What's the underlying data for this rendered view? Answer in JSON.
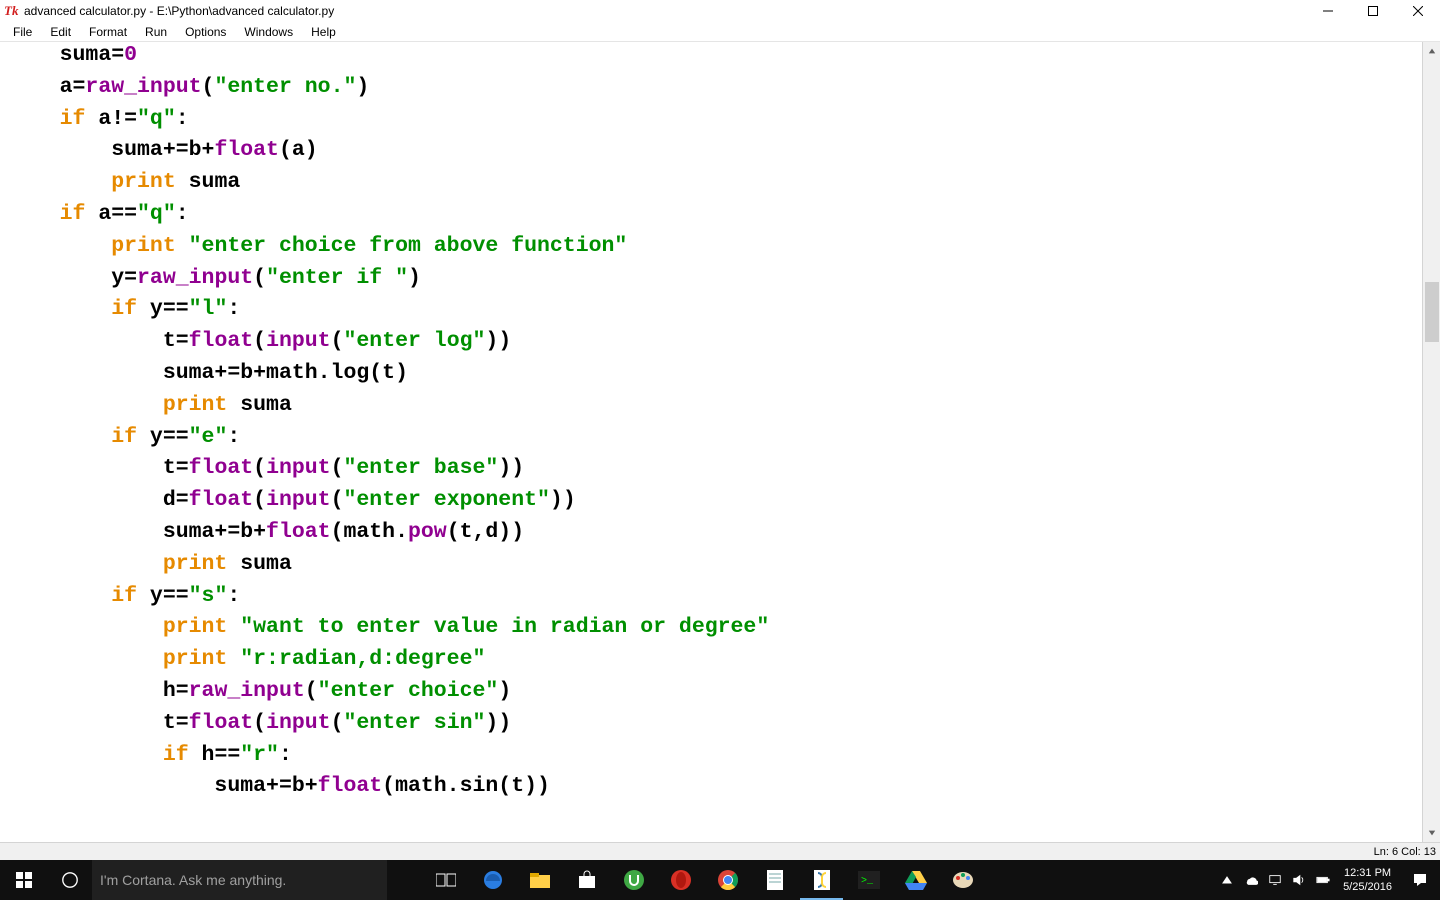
{
  "titlebar": {
    "icon_label": "Tk",
    "title": "advanced calculator.py - E:\\Python\\advanced calculator.py"
  },
  "menubar": {
    "items": [
      "File",
      "Edit",
      "Format",
      "Run",
      "Options",
      "Windows",
      "Help"
    ]
  },
  "code_tokens": [
    [
      [
        "",
        "    suma="
      ],
      [
        "fn",
        "0"
      ]
    ],
    [
      [
        "",
        "    a="
      ],
      [
        "fn",
        "raw_input"
      ],
      [
        "",
        "("
      ],
      [
        "str",
        "\"enter no.\""
      ],
      [
        "",
        ")"
      ]
    ],
    [
      [
        "",
        "    "
      ],
      [
        "kw",
        "if"
      ],
      [
        "",
        " a!="
      ],
      [
        "str",
        "\"q\""
      ],
      [
        "",
        ":"
      ]
    ],
    [
      [
        "",
        "        suma+=b+"
      ],
      [
        "fn",
        "float"
      ],
      [
        "",
        "(a)"
      ]
    ],
    [
      [
        "",
        "        "
      ],
      [
        "kw",
        "print"
      ],
      [
        "",
        " suma"
      ]
    ],
    [
      [
        "",
        "    "
      ],
      [
        "kw",
        "if"
      ],
      [
        "",
        " a=="
      ],
      [
        "str",
        "\"q\""
      ],
      [
        "",
        ":"
      ]
    ],
    [
      [
        "",
        "        "
      ],
      [
        "kw",
        "print"
      ],
      [
        "",
        " "
      ],
      [
        "str",
        "\"enter choice from above function\""
      ]
    ],
    [
      [
        "",
        "        y="
      ],
      [
        "fn",
        "raw_input"
      ],
      [
        "",
        "("
      ],
      [
        "str",
        "\"enter if \""
      ],
      [
        "",
        ")"
      ]
    ],
    [
      [
        "",
        "        "
      ],
      [
        "kw",
        "if"
      ],
      [
        "",
        " y=="
      ],
      [
        "str",
        "\"l\""
      ],
      [
        "",
        ":"
      ]
    ],
    [
      [
        "",
        "            t="
      ],
      [
        "fn",
        "float"
      ],
      [
        "",
        "("
      ],
      [
        "fn",
        "input"
      ],
      [
        "",
        "("
      ],
      [
        "str",
        "\"enter log\""
      ],
      [
        "",
        "))"
      ]
    ],
    [
      [
        "",
        "            suma+=b+math.log(t)"
      ]
    ],
    [
      [
        "",
        "            "
      ],
      [
        "kw",
        "print"
      ],
      [
        "",
        " suma"
      ]
    ],
    [
      [
        "",
        "        "
      ],
      [
        "kw",
        "if"
      ],
      [
        "",
        " y=="
      ],
      [
        "str",
        "\"e\""
      ],
      [
        "",
        ":"
      ]
    ],
    [
      [
        "",
        "            t="
      ],
      [
        "fn",
        "float"
      ],
      [
        "",
        "("
      ],
      [
        "fn",
        "input"
      ],
      [
        "",
        "("
      ],
      [
        "str",
        "\"enter base\""
      ],
      [
        "",
        "))"
      ]
    ],
    [
      [
        "",
        "            d="
      ],
      [
        "fn",
        "float"
      ],
      [
        "",
        "("
      ],
      [
        "fn",
        "input"
      ],
      [
        "",
        "("
      ],
      [
        "str",
        "\"enter exponent\""
      ],
      [
        "",
        "))"
      ]
    ],
    [
      [
        "",
        "            suma+=b+"
      ],
      [
        "fn",
        "float"
      ],
      [
        "",
        "(math."
      ],
      [
        "fn",
        "pow"
      ],
      [
        "",
        "(t,d))"
      ]
    ],
    [
      [
        "",
        "            "
      ],
      [
        "kw",
        "print"
      ],
      [
        "",
        " suma"
      ]
    ],
    [
      [
        "",
        "        "
      ],
      [
        "kw",
        "if"
      ],
      [
        "",
        " y=="
      ],
      [
        "str",
        "\"s\""
      ],
      [
        "",
        ":"
      ]
    ],
    [
      [
        "",
        "            "
      ],
      [
        "kw",
        "print"
      ],
      [
        "",
        " "
      ],
      [
        "str",
        "\"want to enter value in radian or degree\""
      ]
    ],
    [
      [
        "",
        "            "
      ],
      [
        "kw",
        "print"
      ],
      [
        "",
        " "
      ],
      [
        "str",
        "\"r:radian,d:degree\""
      ]
    ],
    [
      [
        "",
        "            h="
      ],
      [
        "fn",
        "raw_input"
      ],
      [
        "",
        "("
      ],
      [
        "str",
        "\"enter choice\""
      ],
      [
        "",
        ")"
      ]
    ],
    [
      [
        "",
        "            t="
      ],
      [
        "fn",
        "float"
      ],
      [
        "",
        "("
      ],
      [
        "fn",
        "input"
      ],
      [
        "",
        "("
      ],
      [
        "str",
        "\"enter sin\""
      ],
      [
        "",
        "))"
      ]
    ],
    [
      [
        "",
        "            "
      ],
      [
        "kw",
        "if"
      ],
      [
        "",
        " h=="
      ],
      [
        "str",
        "\"r\""
      ],
      [
        "",
        ":"
      ]
    ],
    [
      [
        "",
        "                suma+=b+"
      ],
      [
        "fn",
        "float"
      ],
      [
        "",
        "(math.sin(t))"
      ]
    ],
    [
      [
        "",
        "                    "
      ]
    ]
  ],
  "statusbar": {
    "position": "Ln: 6 Col: 13"
  },
  "taskbar": {
    "cortana_placeholder": "I'm Cortana. Ask me anything.",
    "icons": [
      {
        "name": "taskview-icon"
      },
      {
        "name": "edge-icon"
      },
      {
        "name": "fileexplorer-icon"
      },
      {
        "name": "store-icon"
      },
      {
        "name": "utorrent-icon"
      },
      {
        "name": "opera-icon"
      },
      {
        "name": "chrome-icon"
      },
      {
        "name": "notepadpp-icon"
      },
      {
        "name": "python-idle-icon",
        "active": true
      },
      {
        "name": "terminal-icon"
      },
      {
        "name": "drive-icon"
      },
      {
        "name": "paint-icon"
      }
    ],
    "clock": {
      "time": "12:31 PM",
      "date": "5/25/2016"
    }
  }
}
